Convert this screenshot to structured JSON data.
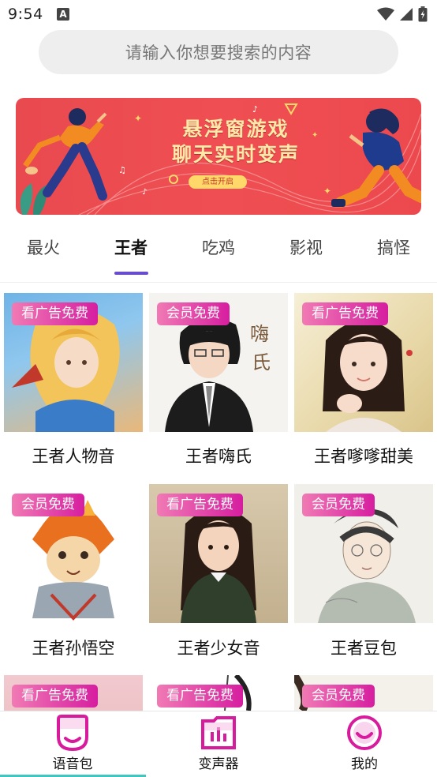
{
  "status_bar": {
    "time": "9:54",
    "notification_glyph": "A",
    "icons": [
      "wifi-icon",
      "signal-icon",
      "battery-icon"
    ]
  },
  "search": {
    "placeholder": "请输入你想要搜索的内容"
  },
  "banner": {
    "line1": "悬浮窗游戏",
    "line2": "聊天实时变声",
    "button_label": "点击开启"
  },
  "tabs": [
    {
      "label": "最火",
      "active": false
    },
    {
      "label": "王者",
      "active": true
    },
    {
      "label": "吃鸡",
      "active": false
    },
    {
      "label": "影视",
      "active": false
    },
    {
      "label": "搞怪",
      "active": false
    }
  ],
  "grid": [
    {
      "badge": "看广告免费",
      "label": "王者人物音"
    },
    {
      "badge": "会员免费",
      "label": "王者嗨氏"
    },
    {
      "badge": "看广告免费",
      "label": "王者嗲嗲甜美"
    },
    {
      "badge": "会员免费",
      "label": "王者孙悟空"
    },
    {
      "badge": "看广告免费",
      "label": "王者少女音"
    },
    {
      "badge": "会员免费",
      "label": "王者豆包"
    },
    {
      "badge": "看广告免费",
      "label": ""
    },
    {
      "badge": "看广告免费",
      "label": ""
    },
    {
      "badge": "会员免费",
      "label": ""
    }
  ],
  "bottom_nav": [
    {
      "label": "语音包",
      "icon": "voice-pack-icon",
      "active": true
    },
    {
      "label": "变声器",
      "icon": "voice-changer-icon",
      "active": false
    },
    {
      "label": "我的",
      "icon": "profile-icon",
      "active": false
    }
  ],
  "colors": {
    "accent_purple": "#6a4ccf",
    "badge_pink": "#d61ea0",
    "nav_magenta": "#d81b9c",
    "banner_red": "#ec494e",
    "nav_indicator": "#3ec6c0"
  }
}
